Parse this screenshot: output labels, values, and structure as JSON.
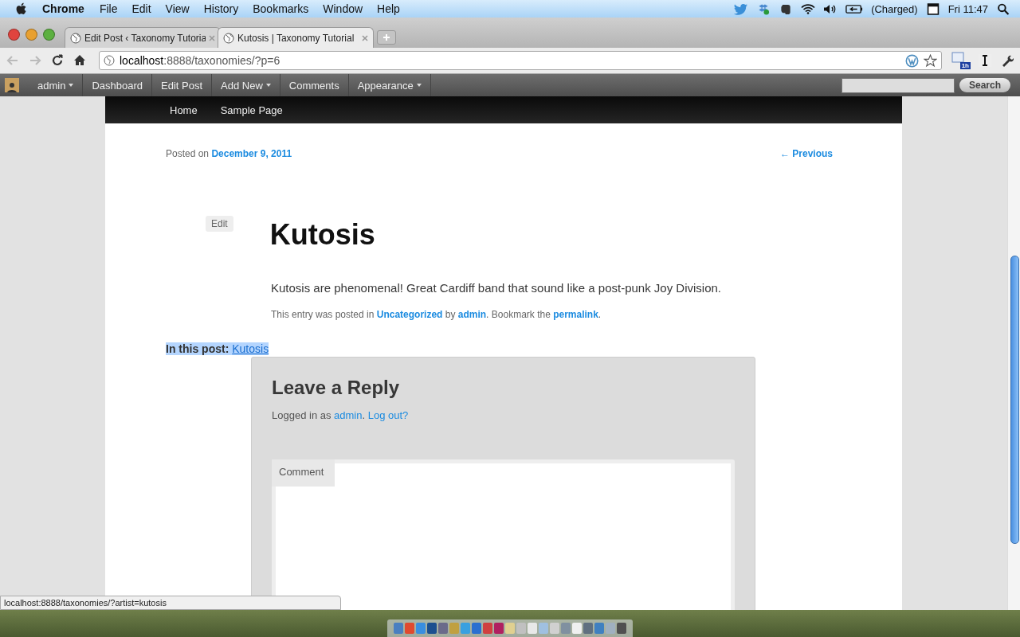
{
  "menubar": {
    "app": "Chrome",
    "items": [
      "File",
      "Edit",
      "View",
      "History",
      "Bookmarks",
      "Window",
      "Help"
    ],
    "battery": "(Charged)",
    "clock": "Fri 11:47"
  },
  "tabs": [
    {
      "title": "Edit Post ‹ Taxonomy Tutoria",
      "selected": false
    },
    {
      "title": "Kutosis | Taxonomy Tutorial",
      "selected": true
    }
  ],
  "address": {
    "host": "localhost",
    "rest": ":8888/taxonomies/?p=6"
  },
  "extension_badge": "1h",
  "admin_bar": {
    "items": [
      {
        "label": "admin",
        "caret": true
      },
      {
        "label": "Dashboard",
        "caret": false
      },
      {
        "label": "Edit Post",
        "caret": false
      },
      {
        "label": "Add New",
        "caret": true
      },
      {
        "label": "Comments",
        "caret": false
      },
      {
        "label": "Appearance",
        "caret": true
      }
    ],
    "search_button": "Search"
  },
  "nav": [
    "Home",
    "Sample Page"
  ],
  "post": {
    "posted_on": "Posted on",
    "date": "December 9, 2011",
    "previous": "← Previous",
    "edit": "Edit",
    "title": "Kutosis",
    "body": "Kutosis are phenomenal! Great Cardiff band that sound like a post-punk Joy Division.",
    "footer": "This entry was posted in **Uncategorized** by **admin**. Bookmark the **permalink**."
  },
  "in_this_post": {
    "label": "In this post:",
    "link": "Kutosis"
  },
  "reply": {
    "title": "Leave a Reply",
    "logged_in": "Logged in as",
    "user": "admin",
    "separator": ".",
    "logout": "Log out?",
    "comment_label": "Comment"
  },
  "status_url": "localhost:8888/taxonomies/?artist=kutosis"
}
